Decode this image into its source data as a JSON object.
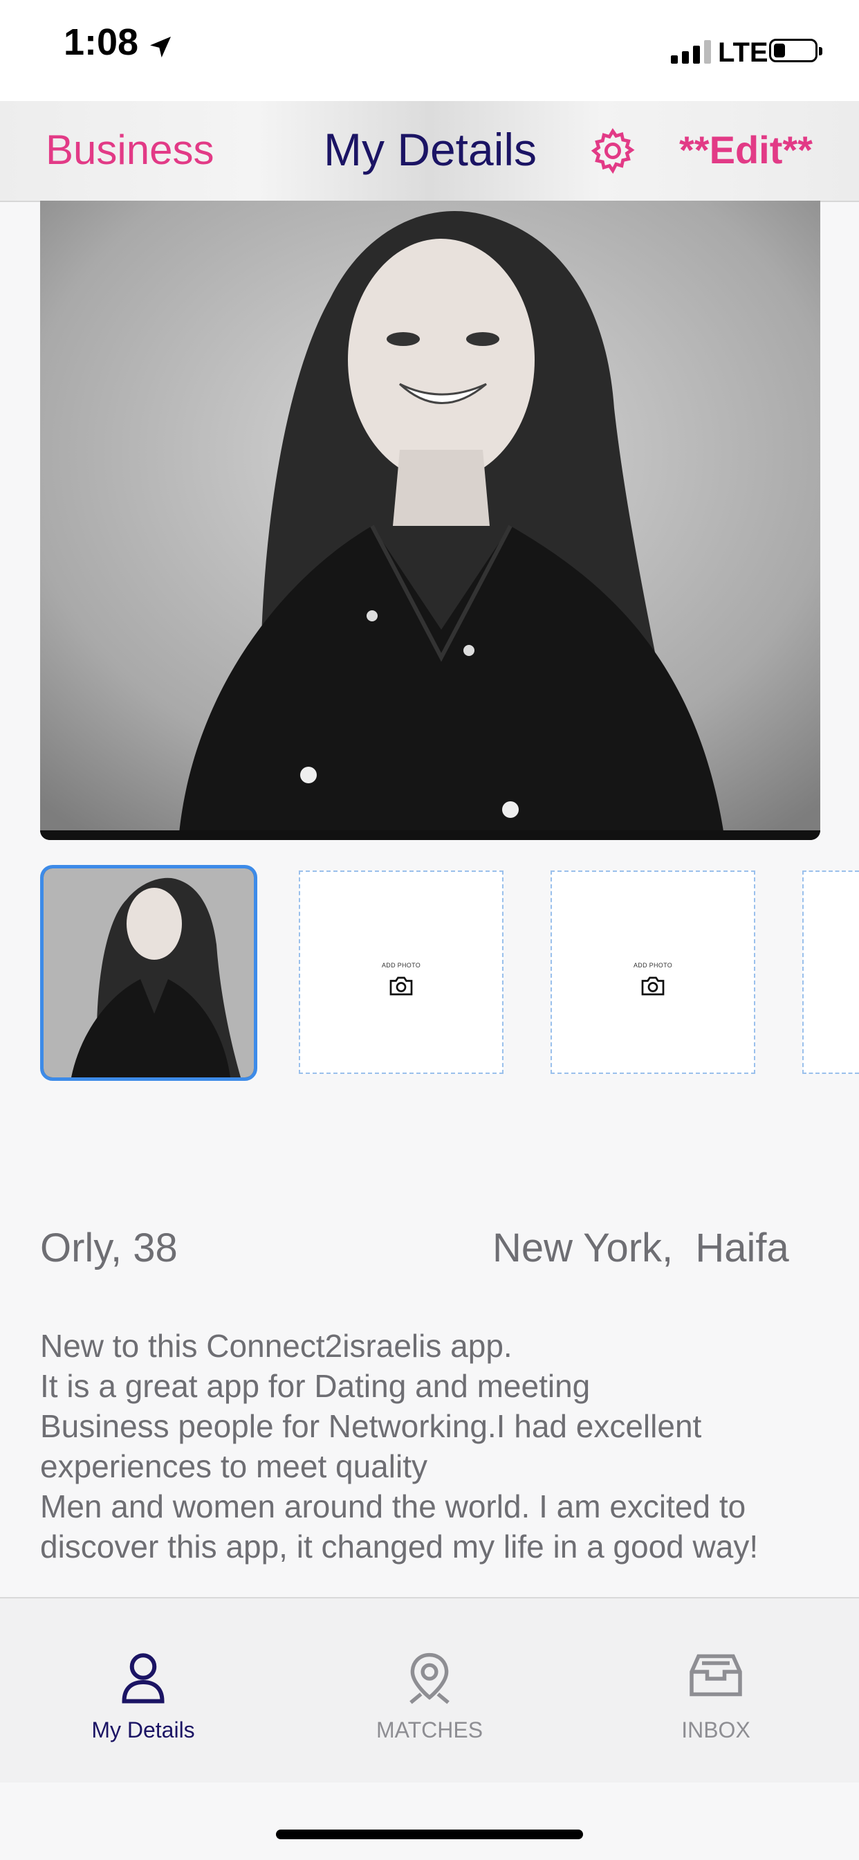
{
  "status_bar": {
    "time": "1:08",
    "network": "LTE"
  },
  "header": {
    "business": "Business",
    "title": "My Details",
    "edit": "**Edit**"
  },
  "photos": {
    "add_label": "ADD PHOTO"
  },
  "profile": {
    "name_age": "Orly, 38",
    "location": "New York,  Haifa"
  },
  "bio_lines": [
    "New to this Connect2israelis app.",
    "It is a great app for Dating and meeting",
    "Business people for Networking.I had excellent",
    "experiences to meet quality",
    "Men and women around the world. I am excited to",
    "discover this app, it changed my life in a good way!"
  ],
  "tabs": [
    {
      "label": "My Details",
      "icon": "person-icon",
      "active": true
    },
    {
      "label": "MATCHES",
      "icon": "map-pin-icon",
      "active": false
    },
    {
      "label": "INBOX",
      "icon": "inbox-tray-icon",
      "active": false
    }
  ],
  "colors": {
    "accent_pink": "#e23a86",
    "navy": "#1b1464",
    "thumb_border": "#3d8be8"
  }
}
